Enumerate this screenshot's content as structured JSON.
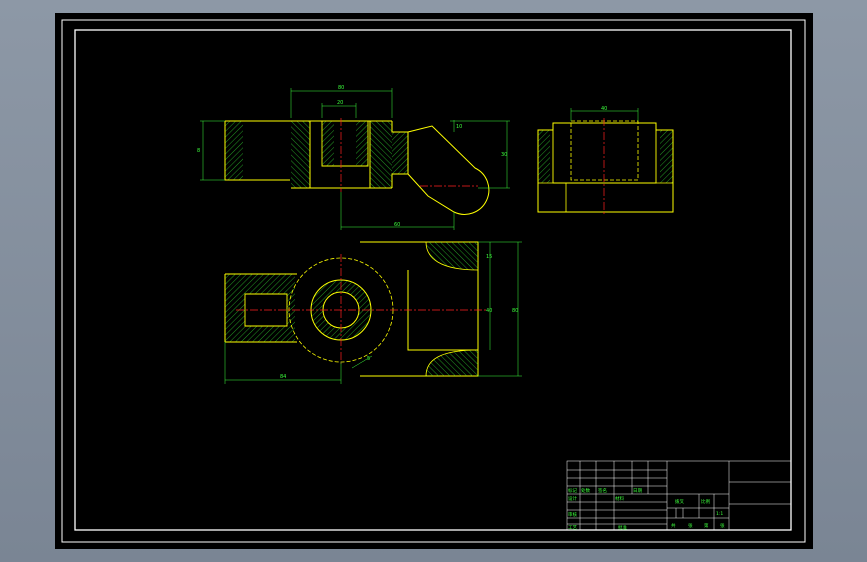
{
  "colors": {
    "background": "#000000",
    "border": "#ffffff",
    "outline": "#ffff00",
    "dimension": "#3cff3c",
    "centerline": "#ff2020",
    "hatch": "#3cff3c",
    "hidden": "#ffff00"
  },
  "dimensions": {
    "top_overall": "80",
    "top_inner": "20",
    "left_height": "8",
    "slot_offset": "10",
    "right_height": "30",
    "bottom_span": "60",
    "side_top": "40",
    "plan_top": "15",
    "plan_mid": "40",
    "plan_overall": "80",
    "plan_bottom": "84",
    "plan_bottom_small": "5"
  },
  "title_block": {
    "part_name": "拨叉",
    "scale_label": "比例",
    "scale_value": "1:1",
    "material_label": "材料",
    "designer_label": "设计",
    "checker_label": "审核",
    "process_label": "工艺",
    "approve_label": "批准",
    "mark_label": "标记",
    "count_label": "处数",
    "sign_label": "签名",
    "date_label": "日期",
    "sheet_1": "共",
    "sheet_2": "张",
    "sheet_3": "第",
    "sheet_4": "张"
  }
}
